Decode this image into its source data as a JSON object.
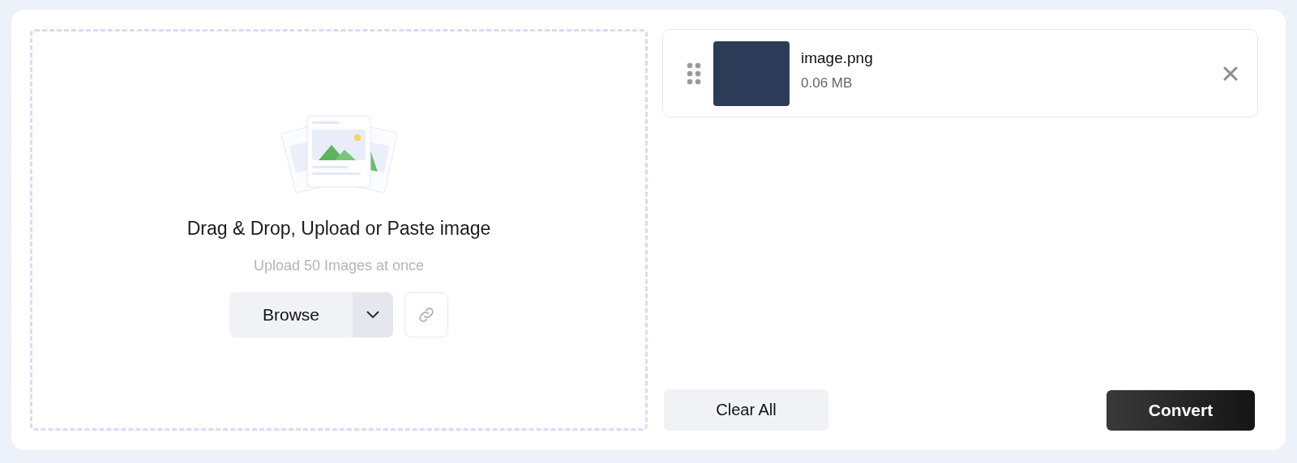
{
  "dropzone": {
    "title": "Drag & Drop, Upload or Paste image",
    "subtitle": "Upload 50 Images at once",
    "browse_label": "Browse"
  },
  "files": [
    {
      "name": "image.png",
      "size": "0.06 MB"
    }
  ],
  "actions": {
    "clear_label": "Clear All",
    "convert_label": "Convert"
  }
}
